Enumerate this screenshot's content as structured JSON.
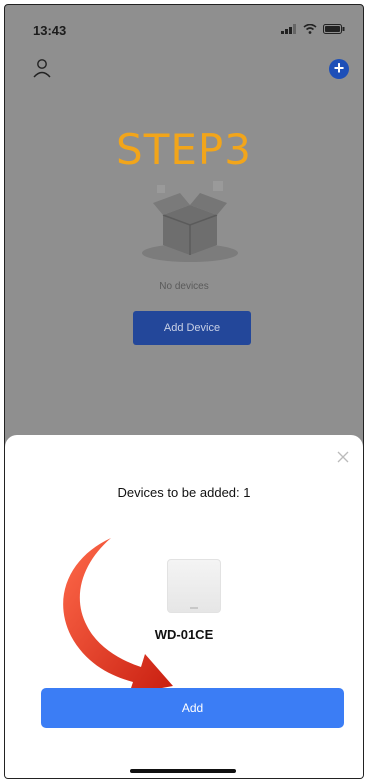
{
  "status_bar": {
    "time": "13:43"
  },
  "background_screen": {
    "step_label": "STEP3",
    "empty_text": "No devices",
    "add_device_label": "Add Device"
  },
  "sheet": {
    "title": "Devices to be added: 1",
    "device_name": "WD-01CE",
    "add_label": "Add"
  },
  "colors": {
    "step_label": "#f2a51a",
    "add_button": "#3b7df5",
    "arrow": "#e2321c"
  }
}
